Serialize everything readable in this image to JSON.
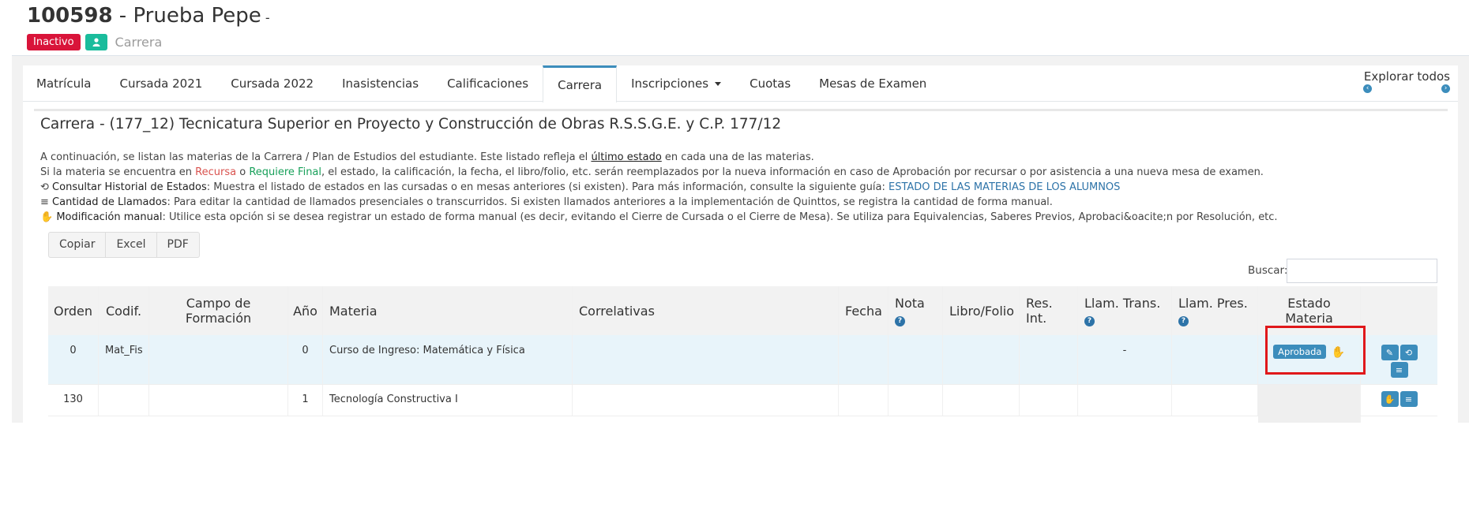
{
  "header": {
    "id": "100598",
    "name": " - Prueba Pepe",
    "suffix": " -",
    "status_badge": "Inactivo",
    "carrera_label": "Carrera"
  },
  "tabs": [
    {
      "label": "Matrícula"
    },
    {
      "label": "Cursada 2021"
    },
    {
      "label": "Cursada 2022"
    },
    {
      "label": "Inasistencias"
    },
    {
      "label": "Calificaciones"
    },
    {
      "label": "Carrera",
      "active": true
    },
    {
      "label": "Inscripciones"
    },
    {
      "label": "Cuotas"
    },
    {
      "label": "Mesas de Examen"
    }
  ],
  "explore": {
    "label": "Explorar todos"
  },
  "section": {
    "title": "Carrera - (177_12) Tecnicatura Superior en Proyecto y Construcción de Obras R.S.S.G.E. y C.P. 177/12"
  },
  "info": {
    "line1_a": "A continuación, se listan las materias de la Carrera / Plan de Estudios del estudiante. Este listado refleja el ",
    "line1_b": "último estado",
    "line1_c": " en cada una de las materias.",
    "line2_a": "Si la materia se encuentra en ",
    "line2_recursa": "Recursa",
    "line2_o": " o ",
    "line2_final": "Requiere Final",
    "line2_c": ", el estado, la calificación, la fecha, el libro/folio, etc. serán reemplazados por la nueva información en caso de Aprobación por recursar o por asistencia a una nueva mesa de examen.",
    "line3_b": "Consultar Historial de Estados",
    "line3_c": ": Muestra el listado de estados en las cursadas o en mesas anteriores (si existen). Para más información, consulte la siguiente guía: ",
    "line3_link": "ESTADO DE LAS MATERIAS DE LOS ALUMNOS",
    "line4_b": "Cantidad de Llamados",
    "line4_c": ": Para editar la cantidad de llamados presenciales o transcurridos. Si existen llamados anteriores a la implementación de Quinttos, se registra la cantidad de forma manual.",
    "line5_b": "Modificación manual",
    "line5_c": ": Utilice esta opción si se desea registrar un estado de forma manual (es decir, evitando el Cierre de Cursada o el Cierre de Mesa). Se utiliza para Equivalencias, Saberes Previos, Aprobaci&oacite;n por Resolución, etc."
  },
  "export_buttons": {
    "copy": "Copiar",
    "excel": "Excel",
    "pdf": "PDF"
  },
  "search": {
    "label": "Buscar:",
    "value": ""
  },
  "table": {
    "headers": {
      "orden": "Orden",
      "codif": "Codif.",
      "campo_1": "Campo de",
      "campo_2": "Formación",
      "anio": "Año",
      "materia": "Materia",
      "correlativas": "Correlativas",
      "fecha": "Fecha",
      "nota": "Nota",
      "libro": "Libro/Folio",
      "res_1": "Res.",
      "res_2": "Int.",
      "llam_trans": "Llam. Trans.",
      "llam_pres": "Llam. Pres.",
      "estado_1": "Estado",
      "estado_2": "Materia"
    },
    "rows": [
      {
        "orden": "0",
        "codif": "Mat_Fis",
        "campo": "",
        "anio": "0",
        "materia": "Curso de Ingreso: Matemática y Física",
        "correlativas": "",
        "fecha": "",
        "nota": "",
        "libro": "",
        "res": "",
        "llam_trans": "-",
        "llam_pres": "",
        "estado": "Aprobada"
      },
      {
        "orden": "130",
        "codif": "",
        "campo": "",
        "anio": "1",
        "materia": "Tecnología Constructiva I",
        "correlativas": "",
        "fecha": "",
        "nota": "",
        "libro": "",
        "res": "",
        "llam_trans": "",
        "llam_pres": "",
        "estado": ""
      }
    ]
  }
}
